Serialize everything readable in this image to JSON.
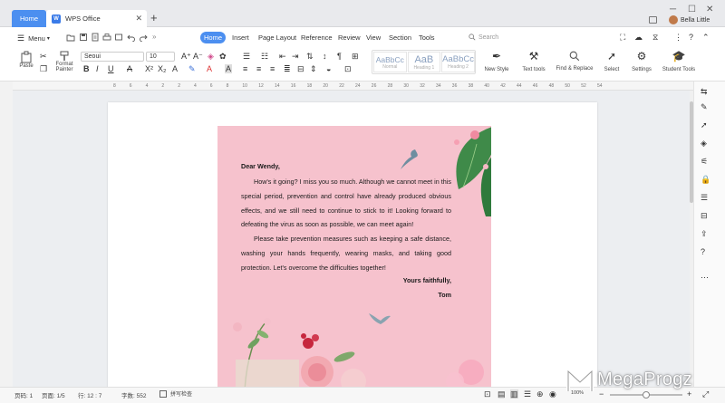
{
  "tabs": {
    "home": "Home",
    "document": "WPS Office"
  },
  "user": {
    "name": "Bella Little"
  },
  "menu": {
    "main_label": "Menu",
    "items": [
      "Home",
      "Insert",
      "Page Layout",
      "Reference",
      "Review",
      "View",
      "Section",
      "Tools"
    ],
    "search_placeholder": "Search"
  },
  "toolbar": {
    "paste": "Paste",
    "format_painter_1": "Format",
    "format_painter_2": "Painter",
    "font_name": "Seoui",
    "font_size": "10",
    "styles": [
      {
        "sample": "AaBbCc",
        "name": "Normal"
      },
      {
        "sample": "AaB",
        "name": "Heading 1"
      },
      {
        "sample": "AaBbCc",
        "name": "Heading 2"
      }
    ],
    "new_style": "New Style",
    "text_tools": "Text tools",
    "find_replace": "Find & Replace",
    "select": "Select",
    "settings": "Settings",
    "student_tools": "Student Tools"
  },
  "ruler_numbers": [
    "8",
    "6",
    "4",
    "2",
    "2",
    "4",
    "6",
    "8",
    "10",
    "12",
    "14",
    "16",
    "18",
    "20",
    "22",
    "24",
    "26",
    "28",
    "30",
    "32",
    "34",
    "36",
    "38",
    "40",
    "42",
    "44",
    "46",
    "48",
    "50",
    "52",
    "54"
  ],
  "letter": {
    "greeting": "Dear Wendy,",
    "paragraph1": "How's it going? I miss you so much. Although we cannot meet in this special period, prevention and control have already produced obvious effects, and we still need to continue to stick to it! Looking forward to defeating the virus as soon as possible, we can meet again!",
    "paragraph2": "Please take prevention measures such as keeping a safe distance, washing your hands frequently, wearing masks, and taking good protection. Let's overcome the difficulties together!",
    "closing": "Yours faithfully,",
    "signature": "Tom"
  },
  "status": {
    "page_no": "页码: 1",
    "page_of": "页面: 1/5",
    "line_col": "行: 12 : 7",
    "word_count": "字数: 552",
    "spell_check": "拼写检查",
    "zoom": "100%"
  },
  "watermark": "MegaProgz",
  "colors": {
    "accent": "#4c8ff0",
    "letter_bg": "#f6c2cd",
    "leaf": "#3d8a4a"
  }
}
